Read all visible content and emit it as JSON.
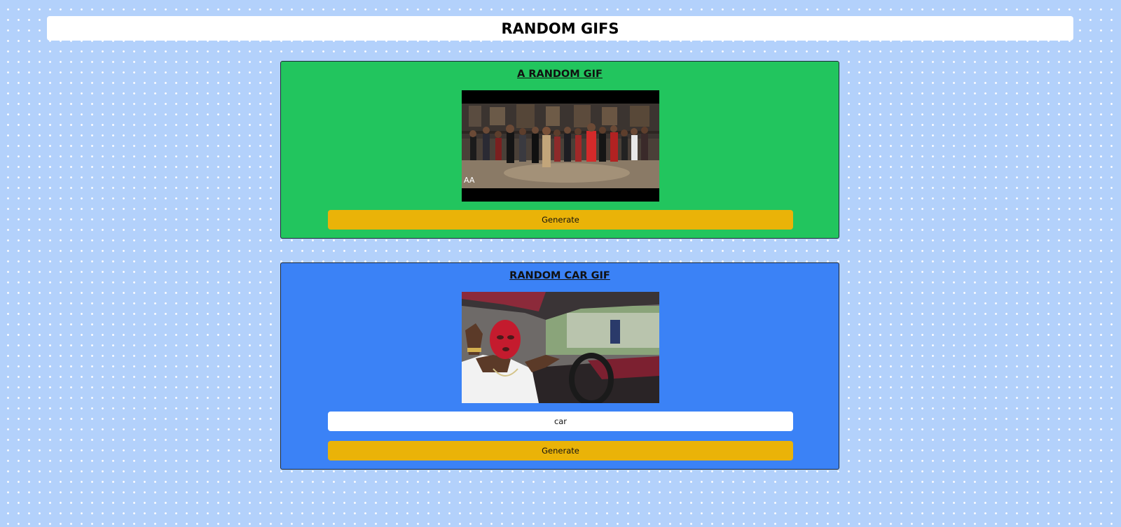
{
  "header": {
    "title": "RANDOM GIFS"
  },
  "random_card": {
    "heading": "A RANDOM GIF",
    "gif_watermark": "AA",
    "generate_label": "Generate",
    "background": "#22c55e"
  },
  "car_card": {
    "heading": "RANDOM CAR GIF",
    "tag_value": "car",
    "generate_label": "Generate",
    "background": "#3b82f6"
  },
  "colors": {
    "page_background": "#b3d1fb",
    "button": "#eab308"
  }
}
